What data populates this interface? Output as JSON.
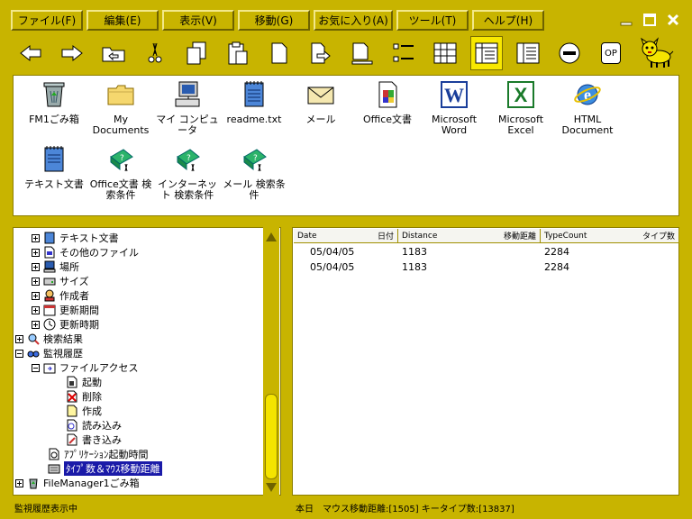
{
  "menu": [
    "ファイル(F)",
    "編集(E)",
    "表示(V)",
    "移動(G)",
    "お気に入り(A)",
    "ツール(T)",
    "ヘルプ(H)"
  ],
  "window_controls": [
    "minimize-icon",
    "maximize-icon",
    "close-icon"
  ],
  "toolbar": {
    "tools": [
      "back-icon",
      "forward-icon",
      "folder-up-icon",
      "cut-icon",
      "copy-icon",
      "paste-icon",
      "new-file-icon",
      "move-icon",
      "delete-icon",
      "view-list-icon",
      "view-large-icons-icon",
      "view-details-icon",
      "view-small-icons-icon",
      "stop-icon",
      "op-icon"
    ],
    "op_label": "OP",
    "mascot": "dog-icon"
  },
  "files": [
    {
      "label": "FM1ごみ箱",
      "icon": "recycle-bin-icon"
    },
    {
      "label": "My Documents",
      "icon": "folder-icon"
    },
    {
      "label": "マイ コンピュータ",
      "icon": "computer-icon"
    },
    {
      "label": "readme.txt",
      "icon": "notepad-icon"
    },
    {
      "label": "メール",
      "icon": "mail-icon"
    },
    {
      "label": "Office文書",
      "icon": "office-doc-icon"
    },
    {
      "label": "Microsoft Word",
      "icon": "word-icon"
    },
    {
      "label": "Microsoft Excel",
      "icon": "excel-icon"
    },
    {
      "label": "HTML Document",
      "icon": "ie-icon"
    },
    {
      "label": "テキスト文書",
      "icon": "text-doc-icon"
    },
    {
      "label": "Office文書 検索条件",
      "icon": "search-condition-icon"
    },
    {
      "label": "インターネット 検索条件",
      "icon": "search-condition-icon"
    },
    {
      "label": "メール 検索条件",
      "icon": "search-condition-icon"
    }
  ],
  "tree": [
    {
      "label": "テキスト文書",
      "state": "closed",
      "icon": "text-doc-icon"
    },
    {
      "label": "その他のファイル",
      "state": "closed",
      "icon": "file-icon"
    },
    {
      "label": "場所",
      "state": "closed",
      "icon": "computer-icon"
    },
    {
      "label": "サイズ",
      "state": "closed",
      "icon": "drive-icon"
    },
    {
      "label": "作成者",
      "state": "closed",
      "icon": "user-icon"
    },
    {
      "label": "更新期間",
      "state": "closed",
      "icon": "calendar-icon"
    },
    {
      "label": "更新時期",
      "state": "closed",
      "icon": "clock-icon"
    },
    {
      "label": "検索結果",
      "state": "closed",
      "icon": "search-icon"
    },
    {
      "label": "監視履歴",
      "state": "open",
      "icon": "glasses-icon"
    },
    {
      "label": "ファイルアクセス",
      "state": "open",
      "icon": "folder-icon"
    },
    {
      "label": "起動",
      "state": "leaf",
      "icon": "launch-icon"
    },
    {
      "label": "削除",
      "state": "leaf",
      "icon": "delete-icon"
    },
    {
      "label": "作成",
      "state": "leaf",
      "icon": "create-icon"
    },
    {
      "label": "読み込み",
      "state": "leaf",
      "icon": "read-icon"
    },
    {
      "label": "書き込み",
      "state": "leaf",
      "icon": "write-icon"
    },
    {
      "label": "ｱﾌﾟﾘｹｰｼｮﾝ起動時間",
      "state": "leaf",
      "icon": "app-time-icon"
    },
    {
      "label": "ﾀｲﾌﾟ数＆ﾏｳｽ移動距離",
      "state": "leaf",
      "icon": "keyboard-icon",
      "selected": true
    },
    {
      "label": "FileManager1ごみ箱",
      "state": "closed",
      "icon": "recycle-bin-icon"
    }
  ],
  "list": {
    "columns": [
      {
        "en": "Date",
        "jp": "日付"
      },
      {
        "en": "Distance",
        "jp": "移動距離"
      },
      {
        "en": "TypeCount",
        "jp": "タイプ数"
      }
    ],
    "rows": [
      [
        "05/04/05",
        "1183",
        "2284"
      ],
      [
        "05/04/05",
        "1183",
        "2284"
      ]
    ]
  },
  "status": {
    "left": "監視履歴表示中",
    "right": "本日　マウス移動距離:[1505] キータイプ数:[13837]"
  }
}
